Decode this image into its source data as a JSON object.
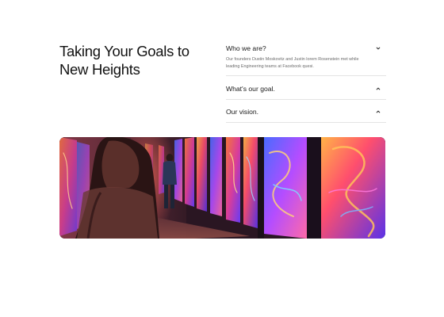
{
  "headline": {
    "line1": "Taking Your Goals to",
    "line2": "New Heights"
  },
  "faq": [
    {
      "question": "Who we are?",
      "answer_line1": "Our founders Dustin Moskovitz and Justin lorem Rosenstein met while",
      "answer_line2": "leading Engineering teams at Facebook quesi.",
      "expanded": true,
      "icon": "chevron-down-icon"
    },
    {
      "question": "What's our goal.",
      "expanded": false,
      "icon": "chevron-up-icon"
    },
    {
      "question": "Our vision.",
      "expanded": false,
      "icon": "chevron-up-icon"
    }
  ],
  "hero_image": {
    "subject": "gallery corridor with glowing psychedelic art panels and visitors"
  }
}
